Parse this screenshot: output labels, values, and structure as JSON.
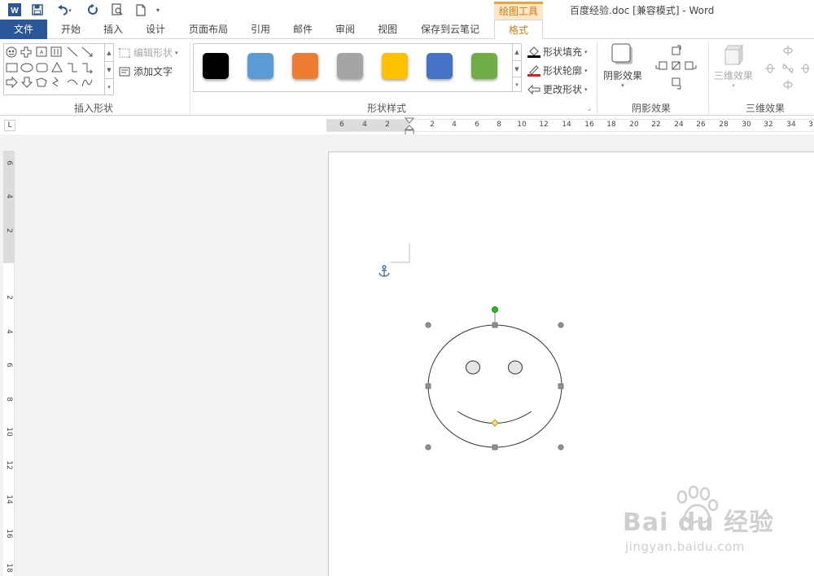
{
  "titlebar": {
    "window_title": "百度经验.doc [兼容模式] - Word",
    "context_tab": "绘图工具",
    "qa_more": "▾"
  },
  "tabs": [
    {
      "label": "文件"
    },
    {
      "label": "开始"
    },
    {
      "label": "插入"
    },
    {
      "label": "设计"
    },
    {
      "label": "页面布局"
    },
    {
      "label": "引用"
    },
    {
      "label": "邮件"
    },
    {
      "label": "审阅"
    },
    {
      "label": "视图"
    },
    {
      "label": "保存到云笔记"
    },
    {
      "label": "格式"
    }
  ],
  "ribbon": {
    "insert_shapes": {
      "label": "插入形状",
      "edit_shape": "编辑形状",
      "add_text": "添加文字"
    },
    "shape_styles": {
      "label": "形状样式",
      "swatches": [
        "#000000",
        "#5b9bd5",
        "#ed7d31",
        "#a5a5a5",
        "#ffc000",
        "#4472c4",
        "#70ad47"
      ],
      "fill": "形状填充",
      "outline": "形状轮廓",
      "change": "更改形状"
    },
    "shadow": {
      "label": "阴影效果",
      "button": "阴影效果"
    },
    "threed": {
      "label": "三维效果",
      "button": "三维效果"
    }
  },
  "ruler": {
    "h_left": [
      "6",
      "4",
      "2"
    ],
    "h_right": [
      "2",
      "4",
      "6",
      "8",
      "10",
      "12",
      "14",
      "16",
      "18",
      "20",
      "22",
      "24",
      "26",
      "28",
      "30",
      "32",
      "34",
      "3"
    ],
    "v_top": [
      "6",
      "4",
      "2"
    ],
    "v_bottom": [
      "2",
      "4",
      "6",
      "8",
      "10",
      "12",
      "14",
      "16",
      "18"
    ],
    "tab_stop": "L"
  },
  "watermark": {
    "text": "Bai du 经验",
    "url": "jingyan.baidu.com"
  },
  "colors": {
    "file_tab": "#2b579a",
    "context_accent": "#d47a12",
    "selection_handle": "#808080",
    "rotate_handle": "#22c022",
    "adjust_handle": "#ffe25a"
  }
}
